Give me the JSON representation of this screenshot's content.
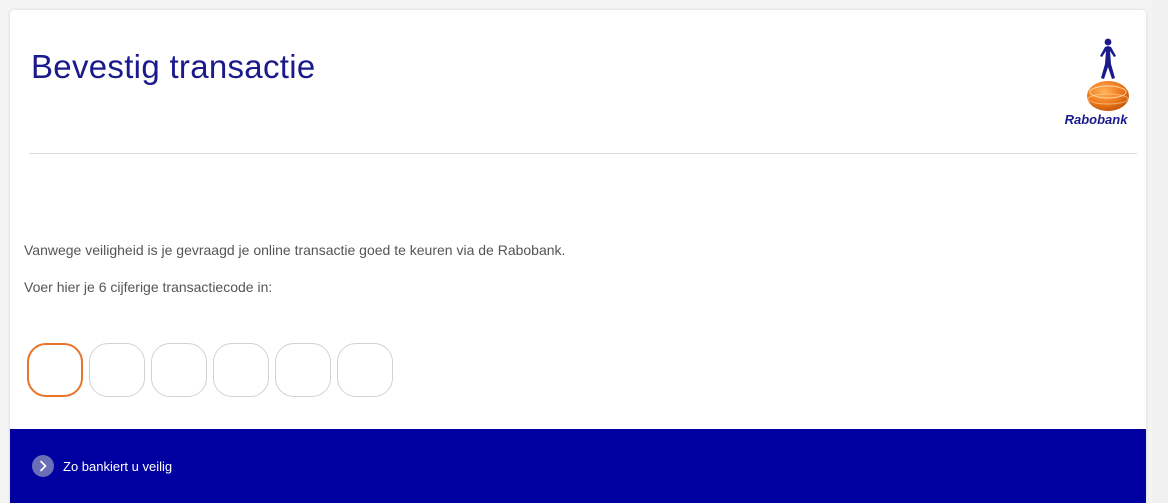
{
  "header": {
    "title": "Bevestig transactie",
    "brand_name": "Rabobank"
  },
  "main": {
    "message_1": "Vanwege veiligheid is je gevraagd je online transactie goed te keuren via de Rabobank.",
    "message_2": "Voer hier je 6 cijferige transactiecode in:",
    "code_inputs": [
      {
        "value": "",
        "focused": true
      },
      {
        "value": "",
        "focused": false
      },
      {
        "value": "",
        "focused": false
      },
      {
        "value": "",
        "focused": false
      },
      {
        "value": "",
        "focused": false
      },
      {
        "value": "",
        "focused": false
      }
    ]
  },
  "footer": {
    "link_label": "Zo bankiert u veilig",
    "link_icon": "chevron-right-icon"
  },
  "colors": {
    "brand_blue": "#1a1a8c",
    "footer_blue": "#0000a0",
    "focus_orange": "#e8742a",
    "input_border": "#d2d2d2"
  }
}
